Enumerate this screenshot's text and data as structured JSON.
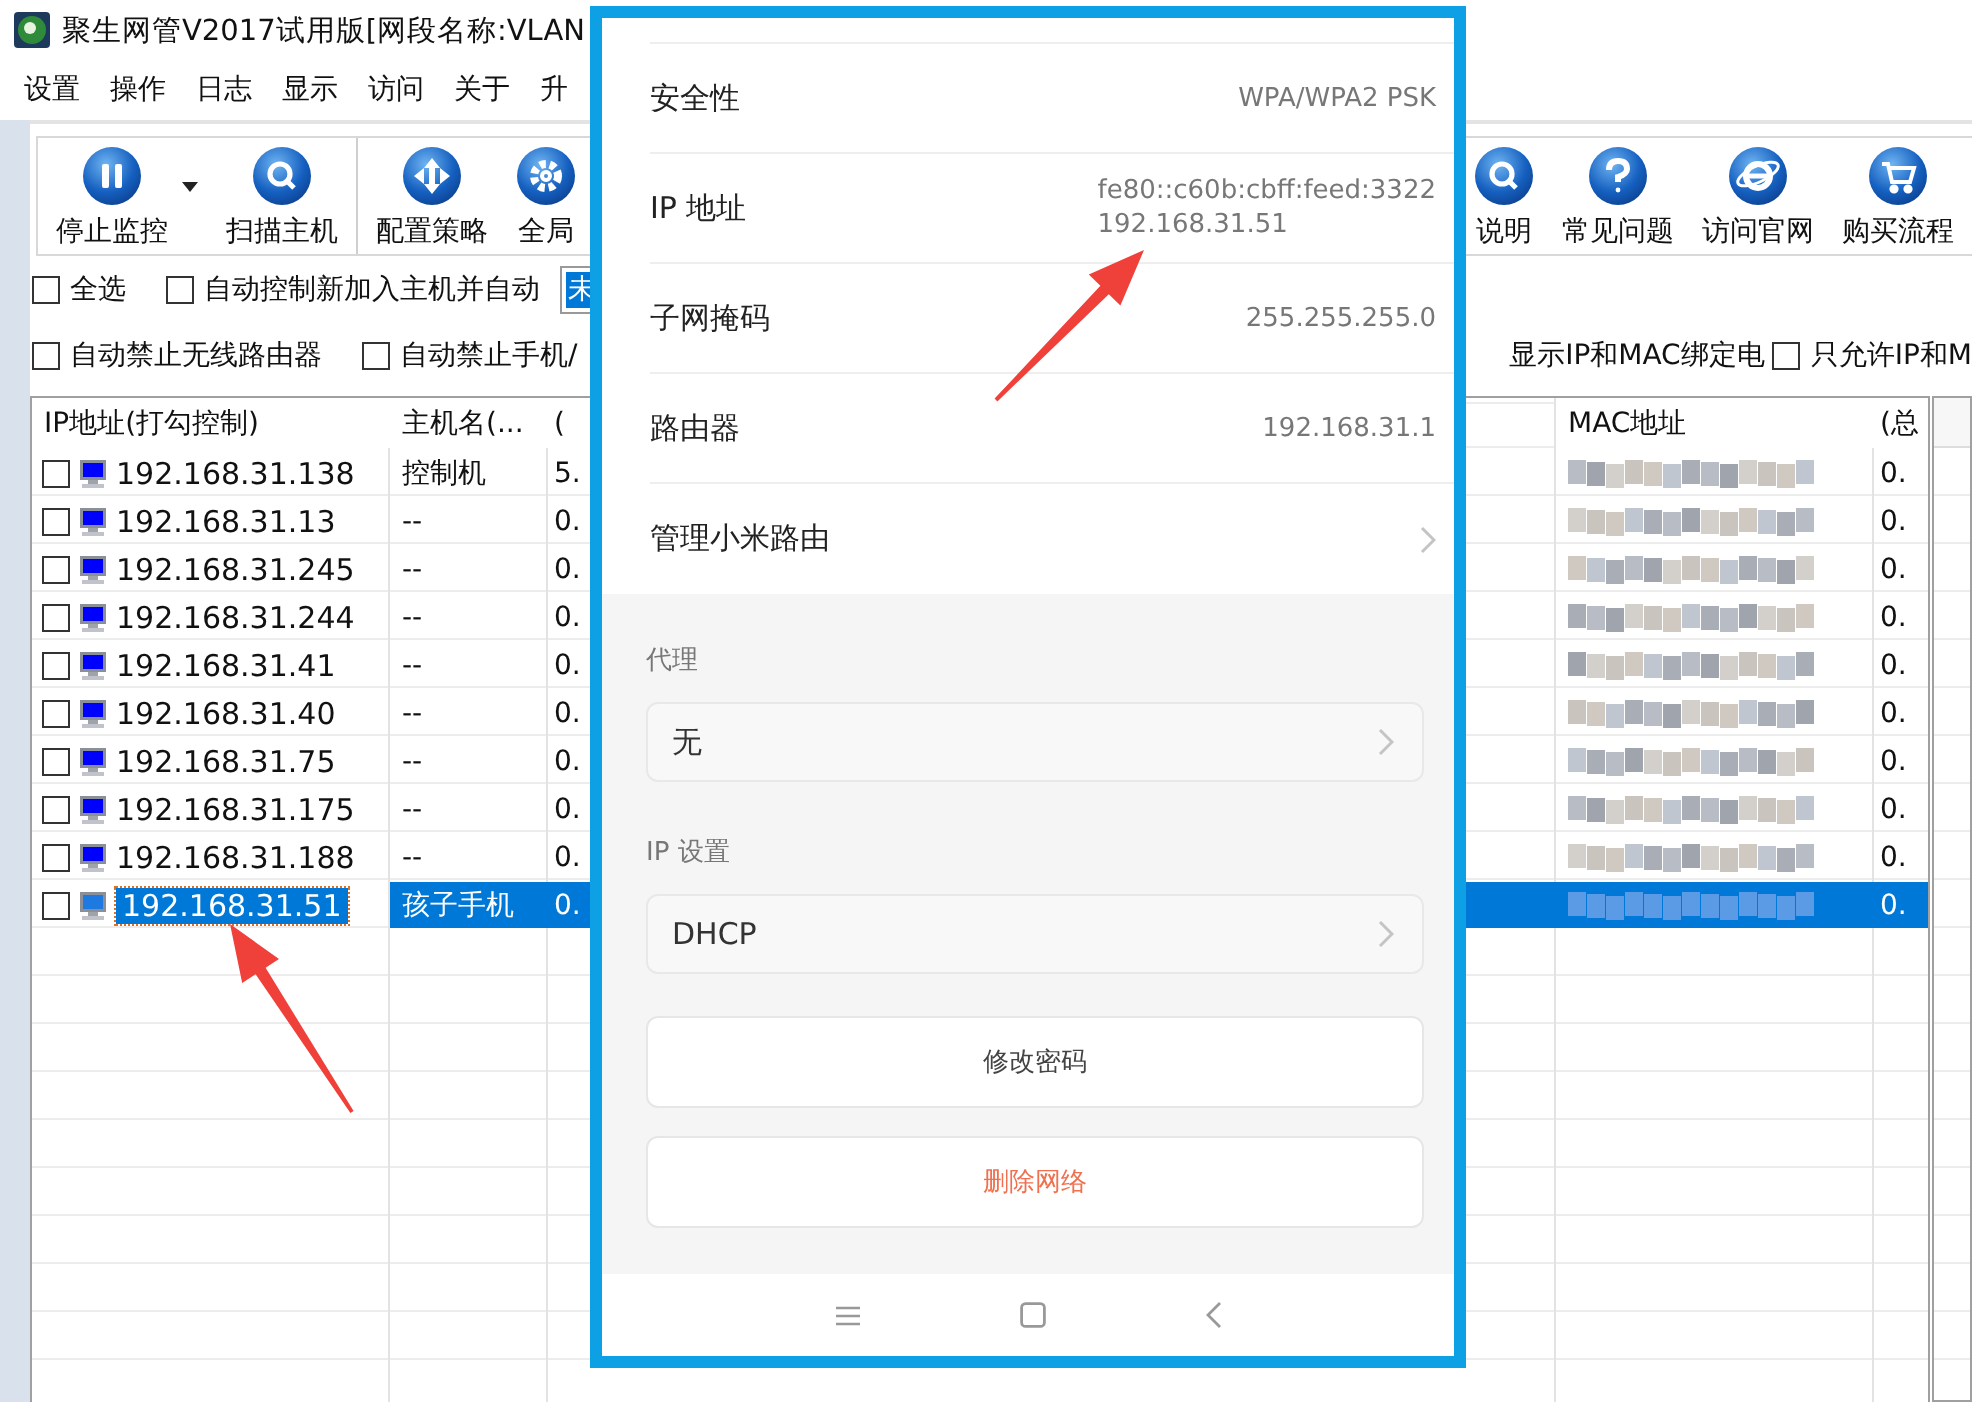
{
  "window": {
    "title": "聚生网管V2017试用版[网段名称:VLAN"
  },
  "menu": [
    "设置",
    "操作",
    "日志",
    "显示",
    "访问",
    "关于",
    "升"
  ],
  "toolbar": {
    "left": [
      {
        "label": "停止监控",
        "kind": "pause",
        "dropdown": true
      },
      {
        "label": "扫描主机",
        "kind": "search",
        "dropdown": false
      }
    ],
    "middle": [
      {
        "label": "配置策略",
        "kind": "move",
        "dropdown": false
      },
      {
        "label": "全局",
        "kind": "gear",
        "dropdown": false
      }
    ],
    "right": [
      {
        "label": "说明",
        "kind": "search",
        "dropdown": false
      },
      {
        "label": "常见问题",
        "kind": "help",
        "dropdown": false
      },
      {
        "label": "访问官网",
        "kind": "browser",
        "dropdown": false
      },
      {
        "label": "购买流程",
        "kind": "cart",
        "dropdown": false
      }
    ]
  },
  "options_row1": [
    {
      "label": "全选",
      "checked": false
    },
    {
      "label": "自动控制新加入主机并自动",
      "checked": false
    }
  ],
  "mode_select": {
    "value": "未"
  },
  "options_row2": [
    {
      "label": "自动禁止无线路由器",
      "checked": false
    },
    {
      "label": "自动禁止手机/",
      "checked": false
    }
  ],
  "options_row2_right_text": "显示IP和MAC绑定电",
  "options_row2_right": [
    {
      "label": "只允许IP和M",
      "checked": false
    }
  ],
  "table": {
    "columns": [
      "IP地址(打勾控制)",
      "主机名(...",
      "(",
      "MAC地址",
      "(总"
    ],
    "rows": [
      {
        "ip": "192.168.31.138",
        "host": "控制机",
        "column_3": "5.",
        "column_5": "0.",
        "checked": false,
        "selected": false
      },
      {
        "ip": "192.168.31.13",
        "host": "--",
        "column_3": "0.",
        "column_5": "0.",
        "checked": false,
        "selected": false
      },
      {
        "ip": "192.168.31.245",
        "host": "--",
        "column_3": "0.",
        "column_5": "0.",
        "checked": false,
        "selected": false
      },
      {
        "ip": "192.168.31.244",
        "host": "--",
        "column_3": "0.",
        "column_5": "0.",
        "checked": false,
        "selected": false
      },
      {
        "ip": "192.168.31.41",
        "host": "--",
        "column_3": "0.",
        "column_5": "0.",
        "checked": false,
        "selected": false
      },
      {
        "ip": "192.168.31.40",
        "host": "--",
        "column_3": "0.",
        "column_5": "0.",
        "checked": false,
        "selected": false
      },
      {
        "ip": "192.168.31.75",
        "host": "--",
        "column_3": "0.",
        "column_5": "0.",
        "checked": false,
        "selected": false
      },
      {
        "ip": "192.168.31.175",
        "host": "--",
        "column_3": "0.",
        "column_5": "0.",
        "checked": false,
        "selected": false
      },
      {
        "ip": "192.168.31.188",
        "host": "--",
        "column_3": "0.",
        "column_5": "0.",
        "checked": false,
        "selected": false
      },
      {
        "ip": "192.168.31.51",
        "host": "孩子手机",
        "column_3": "0.",
        "column_5": "0.",
        "checked": false,
        "selected": true
      }
    ]
  },
  "phone": {
    "details": [
      {
        "label": "安全性",
        "kind": "value",
        "values": [
          "WPA/WPA2 PSK"
        ]
      },
      {
        "label": "IP 地址",
        "kind": "value",
        "values": [
          "fe80::c60b:cbff:feed:3322",
          "192.168.31.51"
        ]
      },
      {
        "label": "子网掩码",
        "kind": "value",
        "values": [
          "255.255.255.0"
        ]
      },
      {
        "label": "路由器",
        "kind": "value",
        "values": [
          "192.168.31.1"
        ]
      },
      {
        "label": "管理小米路由",
        "kind": "link"
      }
    ],
    "settings": [
      {
        "label": "代理",
        "value": "无"
      },
      {
        "label": "IP 设置",
        "value": "DHCP"
      }
    ],
    "buttons": [
      {
        "label": "修改密码",
        "kind": "normal"
      },
      {
        "label": "删除网络",
        "kind": "danger"
      }
    ]
  }
}
